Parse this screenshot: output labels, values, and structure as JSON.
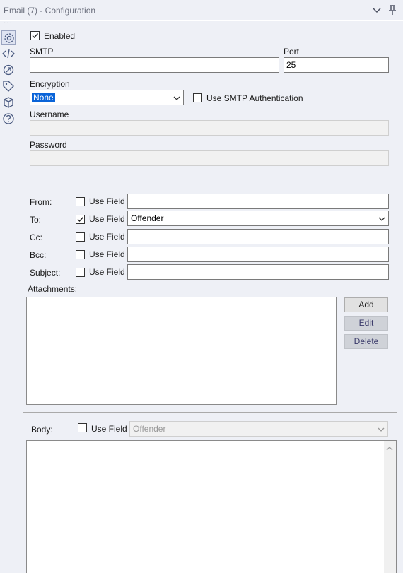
{
  "window": {
    "title": "Email (7) - Configuration"
  },
  "icons": {
    "collapse": "chevron-down-icon",
    "pin": "pin-icon",
    "configuration": "gear-icon",
    "xml": "code-icon",
    "connections": "connection-icon",
    "annotation": "tag-icon",
    "metadata": "cube-icon",
    "help": "help-icon"
  },
  "server": {
    "enabled_label": "Enabled",
    "enabled_checked": true,
    "smtp_label": "SMTP",
    "smtp_value": "",
    "port_label": "Port",
    "port_value": "25",
    "encryption_label": "Encryption",
    "encryption_value": "None",
    "smtp_auth_label": "Use SMTP Authentication",
    "smtp_auth_checked": false,
    "username_label": "Username",
    "username_value": "",
    "password_label": "Password",
    "password_value": ""
  },
  "recipients": {
    "use_field_label": "Use Field",
    "from": {
      "label": "From:",
      "use_field": false,
      "value": ""
    },
    "to": {
      "label": "To:",
      "use_field": true,
      "value": "Offender"
    },
    "cc": {
      "label": "Cc:",
      "use_field": false,
      "value": ""
    },
    "bcc": {
      "label": "Bcc:",
      "use_field": false,
      "value": ""
    },
    "subject": {
      "label": "Subject:",
      "use_field": false,
      "value": ""
    }
  },
  "attachments": {
    "label": "Attachments:",
    "add_label": "Add",
    "edit_label": "Edit",
    "delete_label": "Delete"
  },
  "body": {
    "label": "Body:",
    "use_field_label": "Use Field",
    "use_field": false,
    "field_value": "Offender",
    "content": ""
  }
}
